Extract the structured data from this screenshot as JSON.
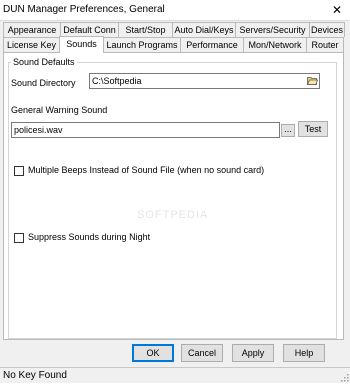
{
  "window": {
    "title": "DUN Manager Preferences, General",
    "close_glyph": "✕"
  },
  "tabs": {
    "row1": [
      {
        "label": "Appearance"
      },
      {
        "label": "Default Conn"
      },
      {
        "label": "Start/Stop"
      },
      {
        "label": "Auto Dial/Keys"
      },
      {
        "label": "Servers/Security"
      },
      {
        "label": "Devices"
      }
    ],
    "row2": [
      {
        "label": "License Key"
      },
      {
        "label": "Sounds",
        "active": true
      },
      {
        "label": "Launch Programs"
      },
      {
        "label": "Performance"
      },
      {
        "label": "Mon/Network"
      },
      {
        "label": "Router"
      }
    ]
  },
  "sounds": {
    "group_title": "Sound Defaults",
    "sound_directory_label": "Sound Directory",
    "sound_directory_value": "C:\\Softpedia",
    "warning_sound_label": "General Warning Sound",
    "warning_sound_value": "policesi.wav",
    "browse_label": "...",
    "test_label": "Test",
    "multiple_beeps_label": "Multiple Beeps Instead of Sound File (when no sound card)",
    "multiple_beeps_checked": false,
    "suppress_night_label": "Suppress Sounds during Night",
    "suppress_night_checked": false,
    "watermark": "SOFTPEDIA"
  },
  "buttons": {
    "ok": "OK",
    "cancel": "Cancel",
    "apply": "Apply",
    "help": "Help"
  },
  "status": {
    "text": "No Key Found"
  },
  "icons": {
    "folder": "folder-open-icon",
    "close": "close-icon",
    "grip": "resize-grip-icon"
  }
}
